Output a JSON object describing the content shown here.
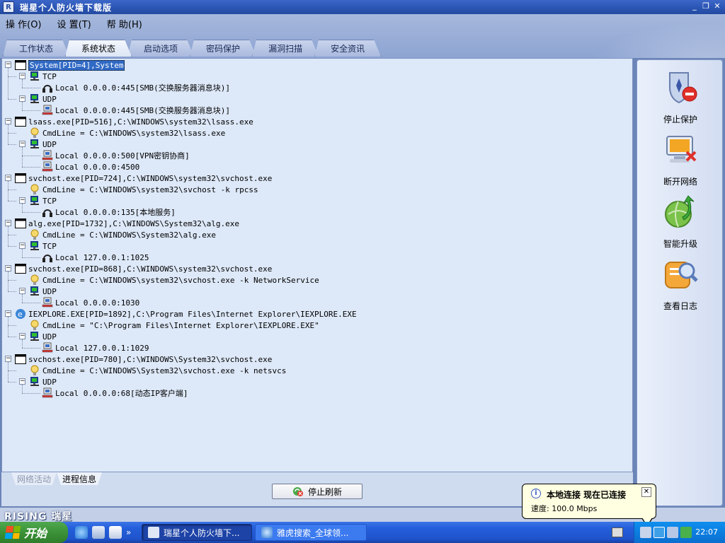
{
  "window": {
    "title": "瑞星个人防火墙下载版",
    "buttons": {
      "minimize": "_",
      "restore": "❐",
      "close": "✕"
    }
  },
  "menu": [
    "操 作(O)",
    "设 置(T)",
    "帮 助(H)"
  ],
  "tabs": [
    "工作状态",
    "系统状态",
    "启动选项",
    "密码保护",
    "漏洞扫描",
    "安全资讯"
  ],
  "active_tab": "系统状态",
  "tree": [
    {
      "level": 0,
      "icon": "window-icon",
      "text": "System[PID=4],System",
      "selected": true,
      "toggle": "−"
    },
    {
      "level": 1,
      "icon": "network-icon",
      "text": "TCP",
      "toggle": "−"
    },
    {
      "level": 2,
      "icon": "headphone-icon",
      "text": "Local 0.0.0.0:445[SMB(交换服务器消息块)]"
    },
    {
      "level": 1,
      "icon": "network-icon",
      "text": "UDP",
      "toggle": "−"
    },
    {
      "level": 2,
      "icon": "computer-net-icon",
      "text": "Local 0.0.0.0:445[SMB(交换服务器消息块)]"
    },
    {
      "level": 0,
      "icon": "window-icon",
      "text": "lsass.exe[PID=516],C:\\WINDOWS\\system32\\lsass.exe",
      "toggle": "−"
    },
    {
      "level": 1,
      "icon": "bulb-icon",
      "text": "CmdLine = C:\\WINDOWS\\system32\\lsass.exe"
    },
    {
      "level": 1,
      "icon": "network-icon",
      "text": "UDP",
      "toggle": "−"
    },
    {
      "level": 2,
      "icon": "computer-net-icon",
      "text": "Local 0.0.0.0:500[VPN密钥协商]"
    },
    {
      "level": 2,
      "icon": "computer-net-icon",
      "text": "Local 0.0.0.0:4500"
    },
    {
      "level": 0,
      "icon": "window-icon",
      "text": "svchost.exe[PID=724],C:\\WINDOWS\\system32\\svchost.exe",
      "toggle": "−"
    },
    {
      "level": 1,
      "icon": "bulb-icon",
      "text": "CmdLine = C:\\WINDOWS\\system32\\svchost -k rpcss"
    },
    {
      "level": 1,
      "icon": "network-icon",
      "text": "TCP",
      "toggle": "−"
    },
    {
      "level": 2,
      "icon": "headphone-icon",
      "text": "Local 0.0.0.0:135[本地服务]"
    },
    {
      "level": 0,
      "icon": "window-icon",
      "text": "alg.exe[PID=1732],C:\\WINDOWS\\System32\\alg.exe",
      "toggle": "−"
    },
    {
      "level": 1,
      "icon": "bulb-icon",
      "text": "CmdLine = C:\\WINDOWS\\System32\\alg.exe"
    },
    {
      "level": 1,
      "icon": "network-icon",
      "text": "TCP",
      "toggle": "−"
    },
    {
      "level": 2,
      "icon": "headphone-icon",
      "text": "Local 127.0.0.1:1025"
    },
    {
      "level": 0,
      "icon": "window-icon",
      "text": "svchost.exe[PID=868],C:\\WINDOWS\\system32\\svchost.exe",
      "toggle": "−"
    },
    {
      "level": 1,
      "icon": "bulb-icon",
      "text": "CmdLine = C:\\WINDOWS\\system32\\svchost.exe -k NetworkService"
    },
    {
      "level": 1,
      "icon": "network-icon",
      "text": "UDP",
      "toggle": "−"
    },
    {
      "level": 2,
      "icon": "computer-net-icon",
      "text": "Local 0.0.0.0:1030"
    },
    {
      "level": 0,
      "icon": "ie-icon",
      "text": "IEXPLORE.EXE[PID=1892],C:\\Program Files\\Internet Explorer\\IEXPLORE.EXE",
      "toggle": "−"
    },
    {
      "level": 1,
      "icon": "bulb-icon",
      "text": "CmdLine = \"C:\\Program Files\\Internet Explorer\\IEXPLORE.EXE\""
    },
    {
      "level": 1,
      "icon": "network-icon",
      "text": "UDP",
      "toggle": "−"
    },
    {
      "level": 2,
      "icon": "computer-net-icon",
      "text": "Local 127.0.0.1:1029"
    },
    {
      "level": 0,
      "icon": "window-icon",
      "text": "svchost.exe[PID=780],C:\\WINDOWS\\System32\\svchost.exe",
      "toggle": "−"
    },
    {
      "level": 1,
      "icon": "bulb-icon",
      "text": "CmdLine = C:\\WINDOWS\\System32\\svchost.exe -k netsvcs"
    },
    {
      "level": 1,
      "icon": "network-icon",
      "text": "UDP",
      "toggle": "−"
    },
    {
      "level": 2,
      "icon": "computer-net-icon",
      "text": "Local 0.0.0.0:68[动态IP客户端]"
    }
  ],
  "bottom_tabs": {
    "network": "网络活动",
    "process": "进程信息"
  },
  "stop_refresh": "停止刷新",
  "actions": [
    {
      "name": "stop-protection",
      "label": "停止保护",
      "icon": "shield-stop-icon"
    },
    {
      "name": "disconnect-network",
      "label": "断开网络",
      "icon": "monitor-disconnect-icon"
    },
    {
      "name": "smart-upgrade",
      "label": "智能升级",
      "icon": "globe-upgrade-icon"
    },
    {
      "name": "view-log",
      "label": "查看日志",
      "icon": "log-search-icon"
    }
  ],
  "brand": "RISING 瑞星",
  "balloon": {
    "title": "本地连接 现在已连接",
    "body": "速度: 100.0 Mbps",
    "close": "✕",
    "info": "i"
  },
  "taskbar": {
    "start": "开始",
    "chevron": "»",
    "task1": "瑞星个人防火墙下...",
    "task2": "雅虎搜索_全球领...",
    "clock": "22:07"
  },
  "colors": {
    "selection": "#316ac5",
    "panel": "#dde8f8",
    "taskbar": "#245edb"
  }
}
